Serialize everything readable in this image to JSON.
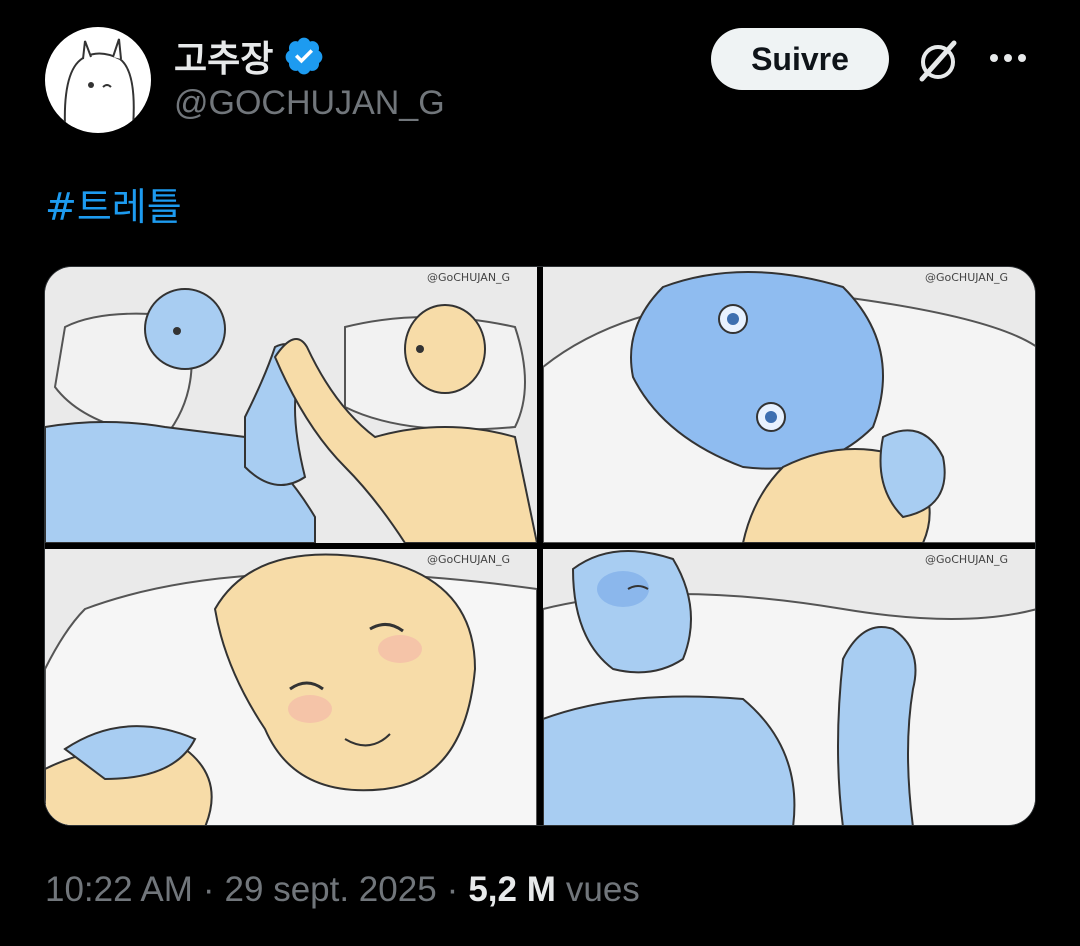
{
  "author": {
    "display_name": "고추장",
    "handle": "@GOCHUJAN_G",
    "verified": true,
    "verified_color": "#1d9bf0"
  },
  "actions": {
    "follow_label": "Suivre",
    "grok_icon": "grok-icon",
    "more_icon": "more-icon"
  },
  "tweet": {
    "hashtag": "#트레틀",
    "watermark": "@GoCHUJAN_G",
    "timestamp": "10:22 AM",
    "date": "29 sept. 2025",
    "separator": "·",
    "views_count": "5,2 M",
    "views_label": "vues"
  },
  "colors": {
    "background": "#000000",
    "text_primary": "#e7e9ea",
    "text_secondary": "#71767b",
    "link": "#1d9bf0",
    "follow_bg": "#eff3f4",
    "blue_character": "#a8cdf2",
    "tan_character": "#f7dca8"
  }
}
